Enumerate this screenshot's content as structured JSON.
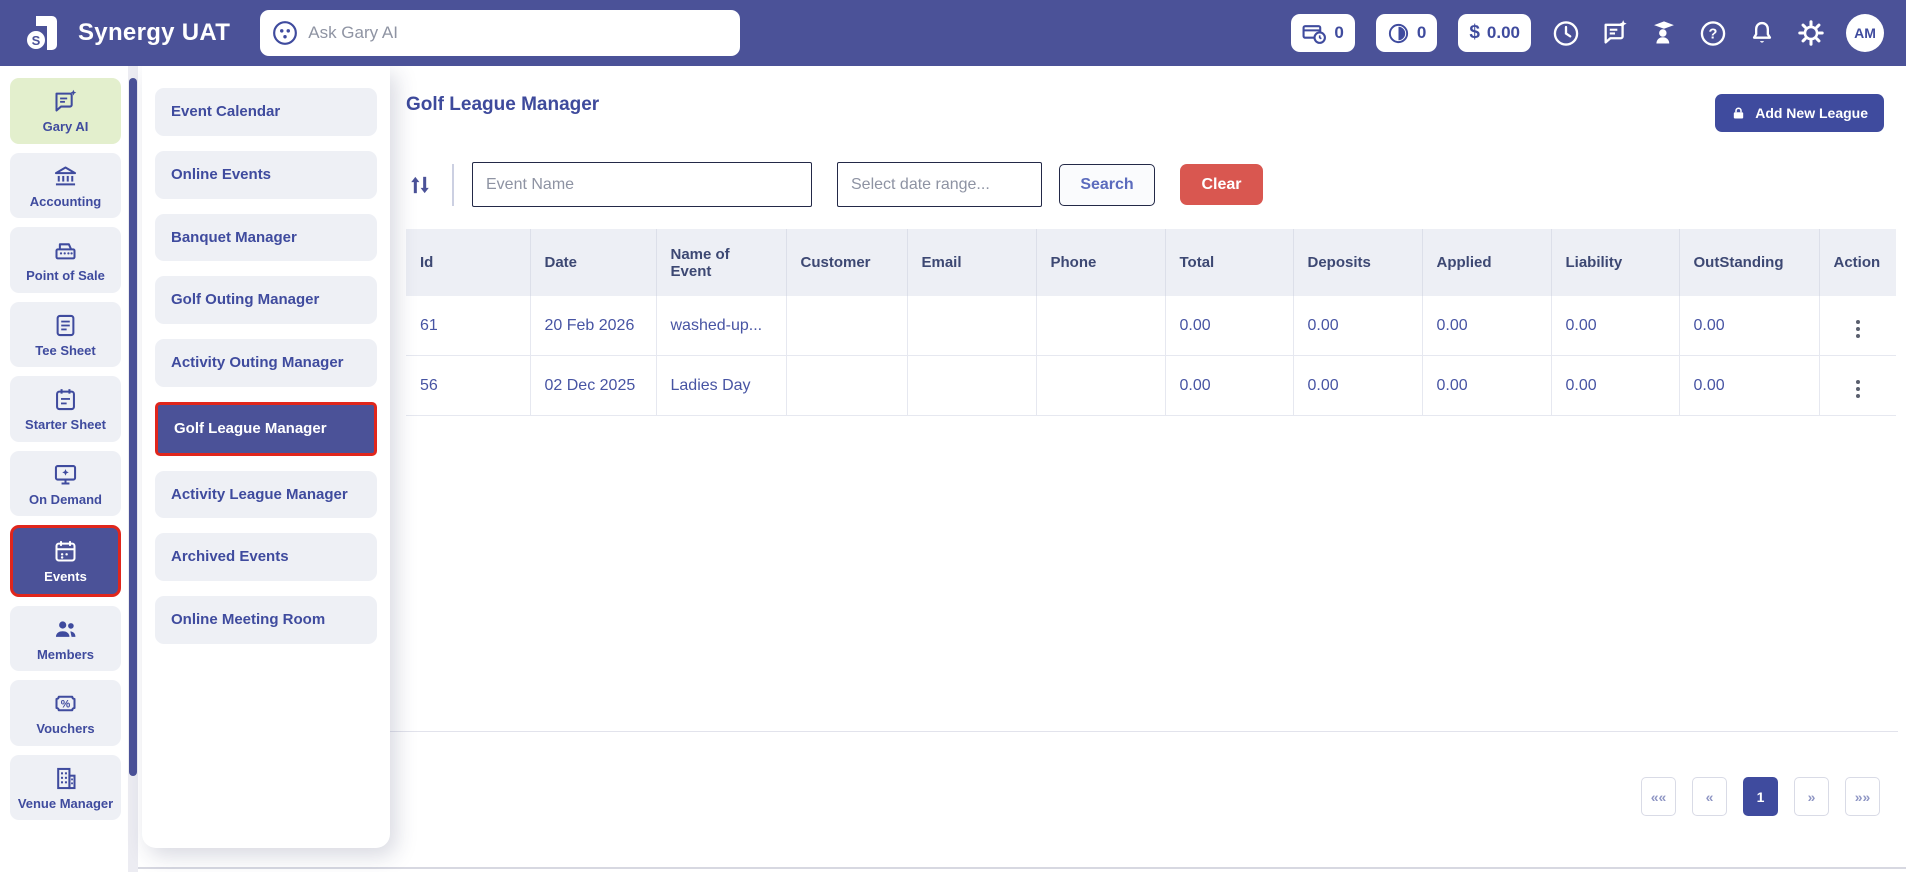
{
  "navbar": {
    "app_title": "Synergy UAT",
    "search_placeholder": "Ask Gary AI",
    "badges": [
      {
        "icon": "card-clock-icon",
        "value": "0"
      },
      {
        "icon": "half-circle-icon",
        "value": "0"
      },
      {
        "icon": "dollar-icon",
        "symbol": "$",
        "value": "0.00"
      }
    ],
    "avatar_initials": "AM"
  },
  "sidebar": {
    "items": [
      {
        "label": "Gary AI",
        "icon": "chat-sparkle-icon",
        "state": "highlight-green"
      },
      {
        "label": "Accounting",
        "icon": "bank-icon",
        "state": "default"
      },
      {
        "label": "Point of Sale",
        "icon": "cash-register-icon",
        "state": "default"
      },
      {
        "label": "Tee Sheet",
        "icon": "document-icon",
        "state": "default"
      },
      {
        "label": "Starter Sheet",
        "icon": "clipboard-icon",
        "state": "default"
      },
      {
        "label": "On Demand",
        "icon": "monitor-sparkle-icon",
        "state": "default"
      },
      {
        "label": "Events",
        "icon": "calendar-icon",
        "state": "active-red-outline"
      },
      {
        "label": "Members",
        "icon": "people-icon",
        "state": "default"
      },
      {
        "label": "Vouchers",
        "icon": "voucher-icon",
        "state": "default"
      },
      {
        "label": "Venue Manager",
        "icon": "building-icon",
        "state": "default"
      }
    ]
  },
  "flyout": {
    "items": [
      {
        "label": "Event Calendar",
        "state": "default"
      },
      {
        "label": "Online Events",
        "state": "default"
      },
      {
        "label": "Banquet Manager",
        "state": "default"
      },
      {
        "label": "Golf Outing Manager",
        "state": "default"
      },
      {
        "label": "Activity Outing Manager",
        "state": "default"
      },
      {
        "label": "Golf League Manager",
        "state": "active-red-outline"
      },
      {
        "label": "Activity League Manager",
        "state": "default"
      },
      {
        "label": "Archived Events",
        "state": "default"
      },
      {
        "label": "Online Meeting Room",
        "state": "default"
      }
    ]
  },
  "page": {
    "title": "Golf League Manager",
    "add_button_label": "Add New League"
  },
  "filters": {
    "event_name_placeholder": "Event Name",
    "date_range_placeholder": "Select date range...",
    "search_label": "Search",
    "clear_label": "Clear"
  },
  "table": {
    "columns": [
      "Id",
      "Date",
      "Name of Event",
      "Customer",
      "Email",
      "Phone",
      "Total",
      "Deposits",
      "Applied",
      "Liability",
      "OutStanding",
      "Action"
    ],
    "rows": [
      {
        "id": "61",
        "date": "20 Feb 2026",
        "name": "washed-up...",
        "customer": "",
        "email": "",
        "phone": "",
        "total": "0.00",
        "deposits": "0.00",
        "applied": "0.00",
        "liability": "0.00",
        "outstanding": "0.00"
      },
      {
        "id": "56",
        "date": "02 Dec 2025",
        "name": "Ladies Day",
        "customer": "",
        "email": "",
        "phone": "",
        "total": "0.00",
        "deposits": "0.00",
        "applied": "0.00",
        "liability": "0.00",
        "outstanding": "0.00"
      }
    ]
  },
  "pagination": {
    "first": "««",
    "prev": "«",
    "page": "1",
    "next": "»",
    "last": "»»"
  },
  "colors": {
    "navbar": "#4b5298",
    "accent": "#3f4b9e",
    "highlight_red": "#e0261c",
    "gary_green": "#e3efcd",
    "item_bg": "#eef0f5",
    "clear_button_red": "#d95750",
    "table_header_bg": "#edeff5"
  }
}
